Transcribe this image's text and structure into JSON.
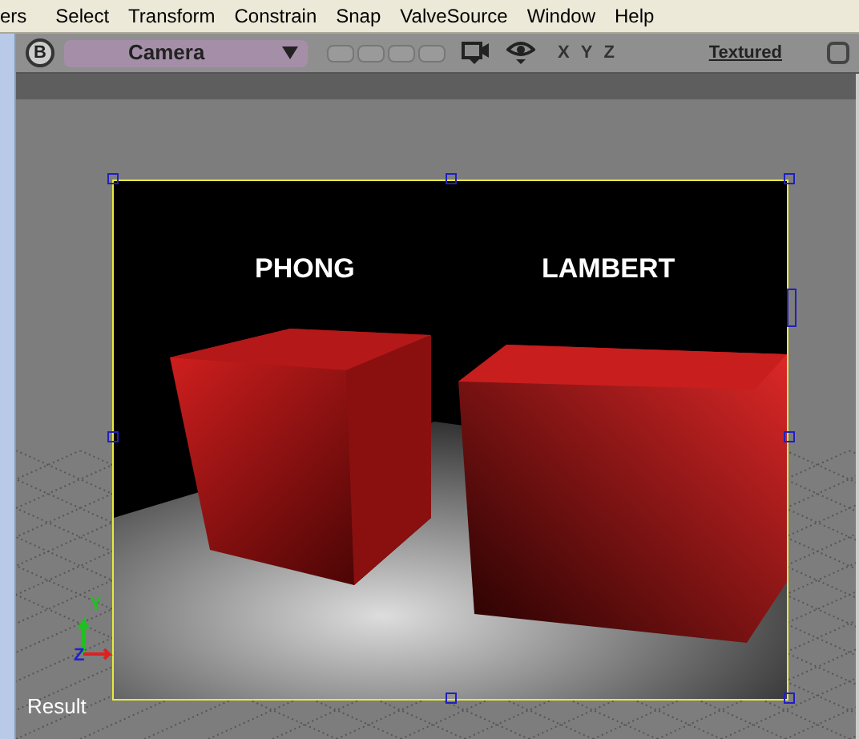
{
  "menu": [
    {
      "label": "ers"
    },
    {
      "label": "Select"
    },
    {
      "label": "Transform"
    },
    {
      "label": "Constrain"
    },
    {
      "label": "Snap"
    },
    {
      "label": "ValveSource"
    },
    {
      "label": "Window"
    },
    {
      "label": "Help"
    }
  ],
  "toolbar": {
    "layout_toggles": [
      {
        "on": false
      },
      {
        "on": false
      },
      {
        "on": false
      },
      {
        "on": false
      }
    ],
    "view_button": "B",
    "camera": "Camera",
    "axes": [
      "X",
      "Y",
      "Z"
    ],
    "display_mode": "Textured"
  },
  "render_region": {
    "labels": [
      "PHONG",
      "LAMBERT"
    ]
  },
  "gizmo": {
    "axes": [
      "Y",
      "Z"
    ]
  },
  "caption": "Result"
}
